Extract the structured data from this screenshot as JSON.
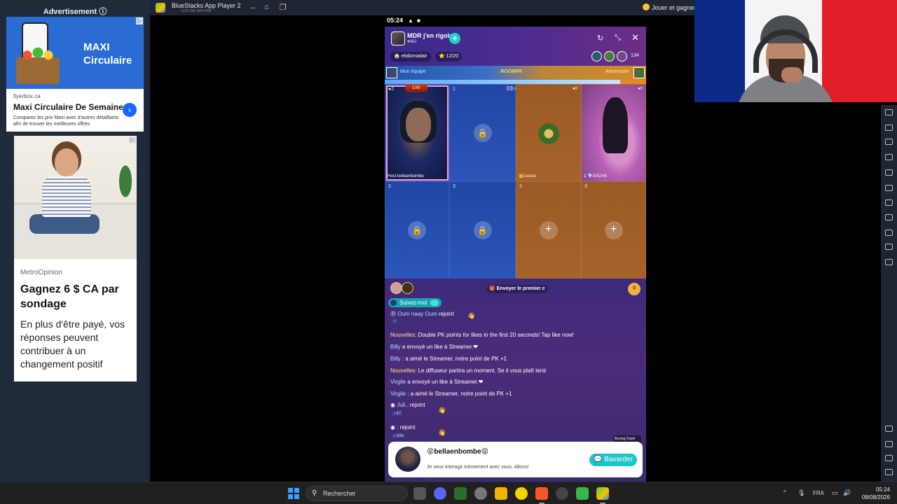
{
  "ads": {
    "label": "Advertisement",
    "ad1": {
      "brand": "MAXI Circulaire",
      "domain": "flyerbox.ca",
      "title": "Maxi Circulaire De Semaine",
      "desc": "Comparez les prix Maxi avec d'autres détaillants afin de trouver les meilleures offres."
    },
    "ad2": {
      "brand": "MetroOpinion",
      "title": "Gagnez 6 $ CA par sondage",
      "desc": "En plus d'être payé, vos réponses peuvent contribuer à un changement positif"
    }
  },
  "bluestacks": {
    "title": "BlueStacks App Player 2",
    "version": "5.22.166.1003  P64",
    "promo": "Jouer et gagner"
  },
  "phone": {
    "status_time": "05:24",
    "room": {
      "name": "MDR j'en rigole",
      "fans": "662",
      "weekly": "ebdomadair",
      "rank": "12/20",
      "viewer_count": "134"
    },
    "pk": {
      "left_label": "Mon équipe",
      "center_label": "ROOMPK",
      "right_label": "Adversaire",
      "timer": "03:44",
      "progress_fraction": 0.9
    },
    "seats": {
      "host_score": "2",
      "host_badge": "LV5",
      "host_label": "Host  bellaenbombe",
      "seat1_num": "1",
      "opp_seat_score": "0",
      "louna_label": "Louna",
      "sacha_num": "1",
      "sacha_label": "SACHA",
      "sacha_score": "0",
      "num2": "2",
      "num3": "3"
    },
    "chat": {
      "send_first": "Envoyer le premier c",
      "follow": "Suivez-moi",
      "lines": [
        {
          "name": "Oum naay Oum",
          "text": " rejoint"
        },
        {
          "name": "Nouvelles:",
          "text": " Double PK points for likes in the first 20 seconds! Tap like now!"
        },
        {
          "name": "Billy",
          "text": " a envoyé un like à Streamer.❤"
        },
        {
          "name": "Billy",
          "text": " : a aimé le Streamer, notre point de PK +1"
        },
        {
          "name": "Nouvelles:",
          "text": " Le diffuseur partira un moment. Se il vous plaît tenir"
        },
        {
          "name": "Virgile",
          "text": " a envoyé un like à Streamer.❤"
        },
        {
          "name": "Virgile",
          "text": " : a aimé le Streamer, notre point de PK +1"
        },
        {
          "name": "Juli...",
          "text": "rejoint"
        },
        {
          "name": "",
          "text": ": rejoint"
        }
      ],
      "lvl_47": "47",
      "lvl_104": "104",
      "boxing": "Boxing Clash"
    },
    "notification": {
      "name": "😝bellaenbombe😝",
      "message": "Je veux interagir intimement avec vous. Allons!",
      "button": "Bavarder"
    }
  },
  "taskbar": {
    "search": "Rechercher",
    "lang": "FRA",
    "time": "05:24",
    "date": "08/08/2026"
  },
  "colors": {
    "accent": "#1cc5c9",
    "team_blue": "#2c55b9",
    "team_orange": "#a6622a"
  }
}
